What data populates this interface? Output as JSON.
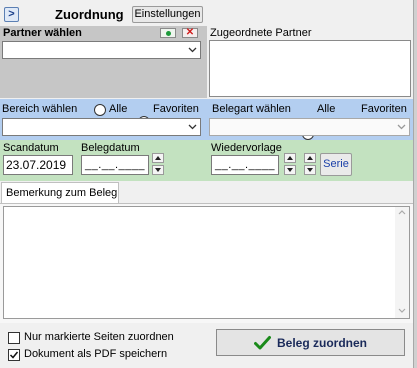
{
  "header": {
    "toggle_glyph": ">",
    "title": "Zuordnung",
    "settings_label": "Einstellungen"
  },
  "partner": {
    "label": "Partner wählen",
    "assigned_label": "Zugeordnete Partner"
  },
  "bereich": {
    "label": "Bereich wählen",
    "alle": "Alle",
    "favoriten": "Favoriten",
    "selected": "Favoriten"
  },
  "belegart": {
    "label": "Belegart wählen",
    "alle": "Alle",
    "favoriten": "Favoriten",
    "selected": "Favoriten"
  },
  "dates": {
    "scandatum_label": "Scandatum",
    "scandatum_value": "23.07.2019",
    "belegdatum_label": "Belegdatum",
    "belegdatum_value": "__.__.____",
    "wiedervorlage_label": "Wiedervorlage",
    "wiedervorlage_value": "__.__.____",
    "serie_label": "Serie"
  },
  "remark": {
    "tab_label": "Bemerkung zum Beleg",
    "value": ""
  },
  "options": {
    "only_marked_label": "Nur markierte Seiten zuordnen",
    "only_marked_checked": false,
    "save_pdf_label": "Dokument als PDF speichern",
    "save_pdf_checked": true
  },
  "action": {
    "assign_label": "Beleg zuordnen"
  },
  "colors": {
    "section_header_bg": "#c6c6c6",
    "blue_band_bg": "#b3cef0",
    "green_band_bg": "#c3e2c0",
    "assigned_box_bg": "#d4d4d4",
    "checkmark_green": "#1a8a1a",
    "serie_text": "#1a3fa8"
  }
}
